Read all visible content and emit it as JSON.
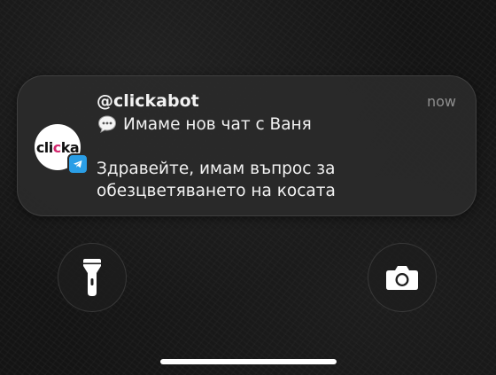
{
  "notification": {
    "sender": "@clickabot",
    "time": "now",
    "icon_emoji": "speech-bubble-icon",
    "title": "Имаме нов чат с Ваня",
    "body": "Здравейте, имам въпрос за обезцветяването на косата",
    "app_logo": {
      "text_prefix": "cli",
      "text_accent": "c",
      "text_suffix": "ka"
    },
    "badge_icon": "telegram-icon"
  },
  "lock_screen": {
    "left_button_icon": "flashlight-icon",
    "right_button_icon": "camera-icon"
  },
  "colors": {
    "brand_accent": "#d3286f",
    "telegram_blue": "#2a9ee6"
  }
}
